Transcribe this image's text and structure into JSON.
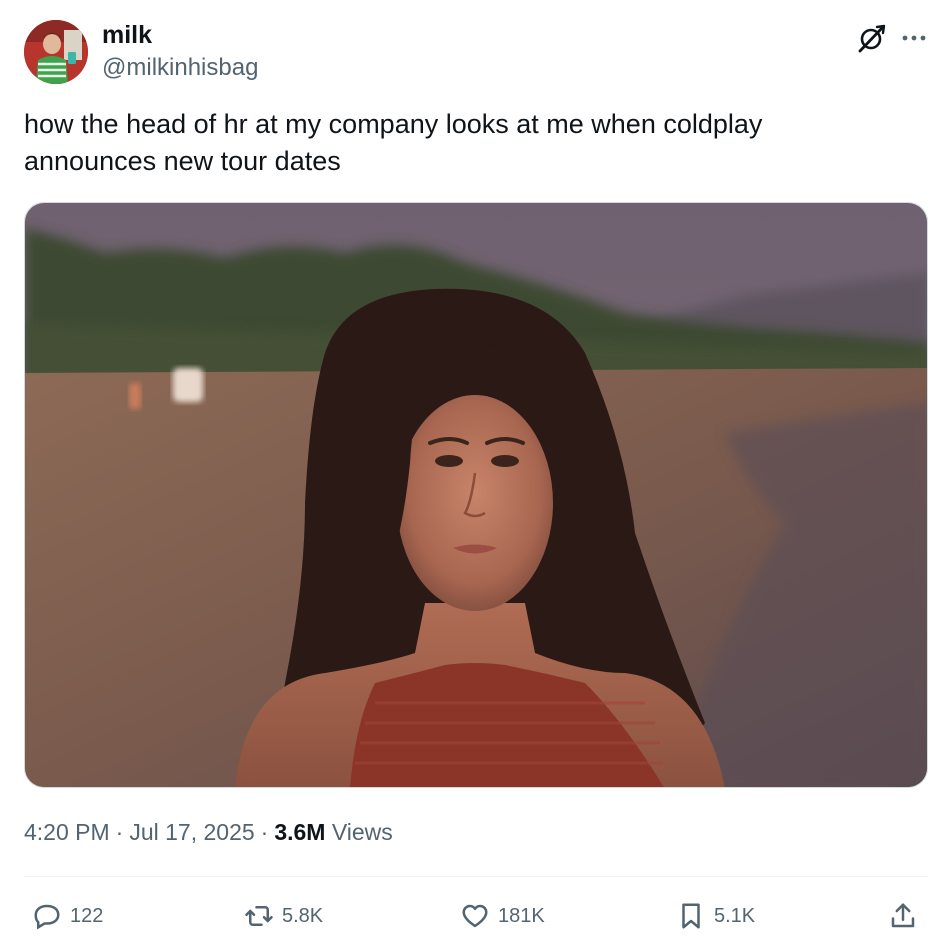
{
  "author": {
    "display_name": "milk",
    "handle": "@milkinhisbag"
  },
  "tweet": {
    "text": "how the head of hr at my company looks at me when coldplay\nannounces new tour dates"
  },
  "meta": {
    "time": "4:20 PM",
    "separator": "·",
    "date": "Jul 17, 2025",
    "views_count": "3.6M",
    "views_label": "Views"
  },
  "actions": {
    "replies": "122",
    "reposts": "5.8K",
    "likes": "181K",
    "bookmarks": "5.1K"
  },
  "icons": {
    "reply": "reply-icon",
    "repost": "repost-icon",
    "like": "heart-icon",
    "bookmark": "bookmark-icon",
    "share": "share-icon",
    "grok": "grok-icon",
    "more": "more-icon"
  },
  "colors": {
    "text_primary": "#0f1419",
    "text_secondary": "#536471",
    "border": "#cfd9de"
  }
}
